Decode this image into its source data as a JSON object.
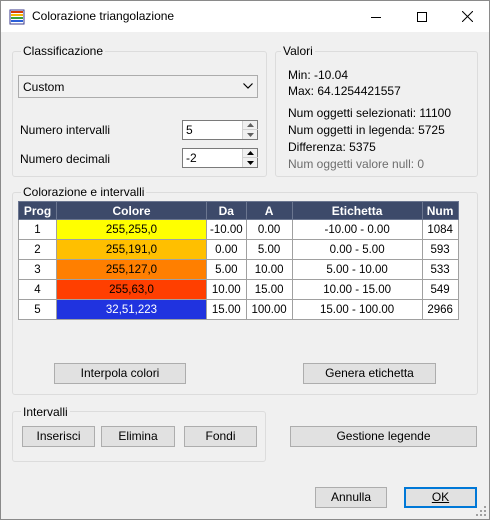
{
  "window": {
    "title": "Colorazione triangolazione"
  },
  "classificazione": {
    "group_label": "Classificazione",
    "combo_value": "Custom",
    "intervals_label": "Numero intervalli",
    "intervals_value": "5",
    "decimals_label": "Numero decimali",
    "decimals_value": "-2"
  },
  "valori": {
    "group_label": "Valori",
    "min": "Min: -10.04",
    "max": "Max: 64.1254421557",
    "selected": "Num oggetti selezionati: 11100",
    "legend": "Num oggetti in legenda: 5725",
    "diff": "Differenza: 5375",
    "null_objs": "Num oggetti valore null: 0"
  },
  "colorazione": {
    "group_label": "Colorazione e intervalli",
    "headers": {
      "prog": "Prog",
      "colore": "Colore",
      "da": "Da",
      "a": "A",
      "etichetta": "Etichetta",
      "num": "Num"
    },
    "rows": [
      {
        "prog": "1",
        "colore": "255,255,0",
        "bg": "#ffff00",
        "da": "-10.00",
        "a": "0.00",
        "etichetta": "-10.00 - 0.00",
        "num": "1084"
      },
      {
        "prog": "2",
        "colore": "255,191,0",
        "bg": "#ffbf00",
        "da": "0.00",
        "a": "5.00",
        "etichetta": "0.00 - 5.00",
        "num": "593"
      },
      {
        "prog": "3",
        "colore": "255,127,0",
        "bg": "#ff7f00",
        "da": "5.00",
        "a": "10.00",
        "etichetta": "5.00 - 10.00",
        "num": "533"
      },
      {
        "prog": "4",
        "colore": "255,63,0",
        "bg": "#ff3f00",
        "da": "10.00",
        "a": "15.00",
        "etichetta": "10.00 - 15.00",
        "num": "549"
      },
      {
        "prog": "5",
        "colore": "32,51,223",
        "bg": "#2033df",
        "da": "15.00",
        "a": "100.00",
        "etichetta": "15.00 - 100.00",
        "num": "2966"
      }
    ],
    "interpola_label": "Interpola colori",
    "genera_label": "Genera etichetta"
  },
  "intervalli": {
    "group_label": "Intervalli",
    "inserisci_label": "Inserisci",
    "elimina_label": "Elimina",
    "fondi_label": "Fondi"
  },
  "gestione_label": "Gestione legende",
  "footer": {
    "annulla_label": "Annulla",
    "ok_label": "OK"
  },
  "colors": {
    "header_bg": "#3d4a6a",
    "accent": "#0078d7"
  }
}
